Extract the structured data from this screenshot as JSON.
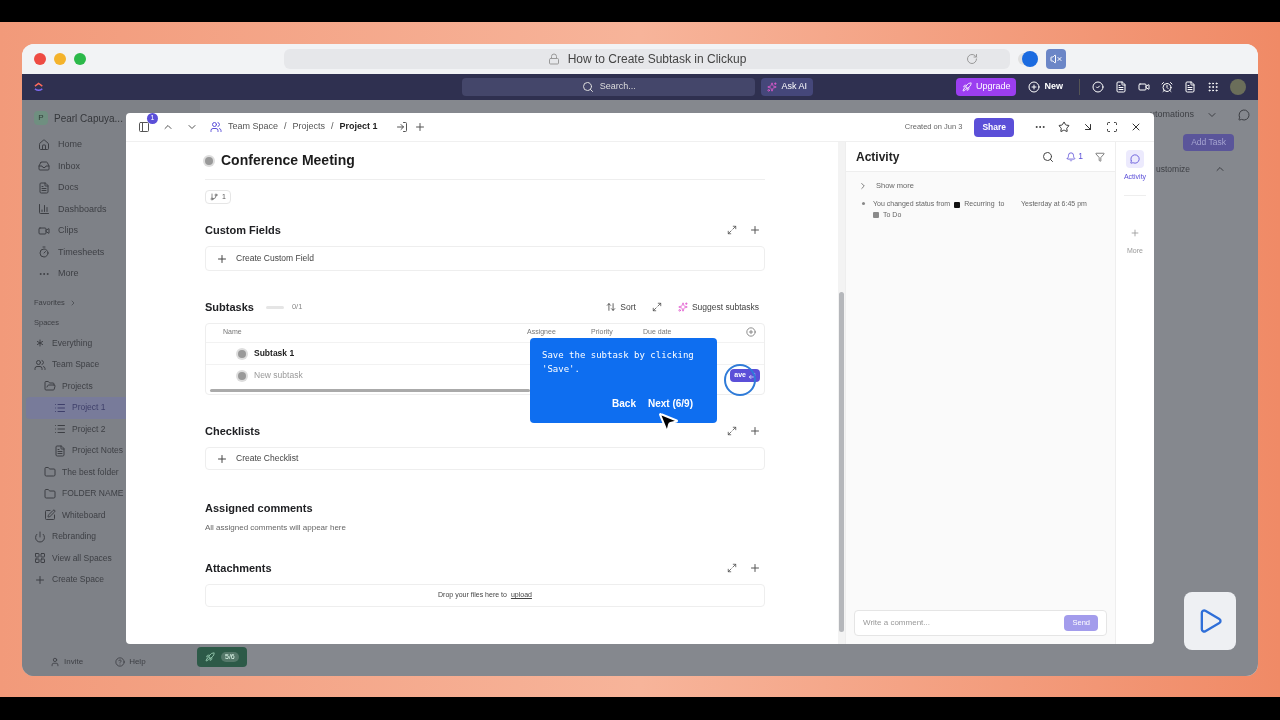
{
  "browser": {
    "title": "How to Create Subtask in Clickup"
  },
  "app_bar": {
    "search_placeholder": "Search...",
    "ask_ai": "Ask AI",
    "upgrade": "Upgrade",
    "new": "New"
  },
  "sidebar": {
    "workspace_initial": "P",
    "workspace_name": "Pearl Capuya...",
    "nav": [
      "Home",
      "Inbox",
      "Docs",
      "Dashboards",
      "Clips",
      "Timesheets",
      "More"
    ],
    "favorites": "Favorites",
    "spaces": "Spaces",
    "tree": [
      {
        "kind": "everything",
        "label": "Everything",
        "selected": false
      },
      {
        "kind": "team",
        "label": "Team Space",
        "selected": false,
        "children": [
          {
            "kind": "folder",
            "label": "Projects",
            "selected": false,
            "children": [
              {
                "kind": "list",
                "label": "Project 1",
                "selected": true
              },
              {
                "kind": "list",
                "label": "Project 2",
                "selected": false
              },
              {
                "kind": "doc",
                "label": "Project Notes",
                "selected": false
              }
            ]
          },
          {
            "kind": "folder",
            "label": "The best folder",
            "selected": false
          },
          {
            "kind": "folder",
            "label": "FOLDER NAME",
            "selected": false
          },
          {
            "kind": "whiteboard",
            "label": "Whiteboard",
            "selected": false
          }
        ]
      },
      {
        "kind": "space",
        "label": "Rebranding",
        "selected": false
      },
      {
        "kind": "view-all",
        "label": "View all Spaces",
        "selected": false
      },
      {
        "kind": "create",
        "label": "Create Space",
        "selected": false
      }
    ],
    "footer": [
      "Invite",
      "Help"
    ]
  },
  "badge": "5/6",
  "background": {
    "automations": "utomations",
    "add_task": "Add Task",
    "customize": "ustomize"
  },
  "modal": {
    "notifications": "1",
    "breadcrumb": [
      "Team Space",
      "Projects",
      "Project 1"
    ],
    "separators": [
      "/",
      "/"
    ],
    "created": "Created on Jun 3",
    "share": "Share",
    "title": "Conference Meeting",
    "subtask_count": "1",
    "custom_fields": {
      "title": "Custom Fields",
      "action": "Create Custom Field"
    },
    "subtasks": {
      "title": "Subtasks",
      "level": 0,
      "progress": "0/1",
      "sort": "Sort",
      "suggest": "Suggest subtasks",
      "columns": [
        "Name",
        "Assignee",
        "Priority",
        "Due date"
      ],
      "rows": [
        {
          "kind": "task",
          "name": "Subtask 1"
        },
        {
          "kind": "new",
          "placeholder": "New subtask",
          "save": "ave"
        }
      ]
    },
    "checklists": {
      "title": "Checklists",
      "action": "Create Checklist"
    },
    "assigned": {
      "title": "Assigned comments",
      "note": "All assigned comments will appear here"
    },
    "attachments": {
      "title": "Attachments",
      "drop": "Drop your files here to",
      "link": "upload"
    }
  },
  "tooltip": {
    "text": "Save the subtask by clicking 'Save'.",
    "back": "Back",
    "next": "Next (6/9)"
  },
  "activity": {
    "title": "Activity",
    "notifications": "1",
    "show_more": "Show more",
    "entries": [
      {
        "text": "You changed status from",
        "statuses": [
          {
            "label": "Recurring",
            "color": "#111111"
          },
          {
            "label": "To Do",
            "color": "#8a8a8a"
          }
        ],
        "joiner": "to",
        "time": "Yesterday at 6:45 pm"
      }
    ],
    "tabs": [
      {
        "label": "Activity",
        "selected": true
      },
      {
        "label": "More",
        "selected": false
      }
    ],
    "comment_placeholder": "Write a comment...",
    "send": "Send"
  }
}
